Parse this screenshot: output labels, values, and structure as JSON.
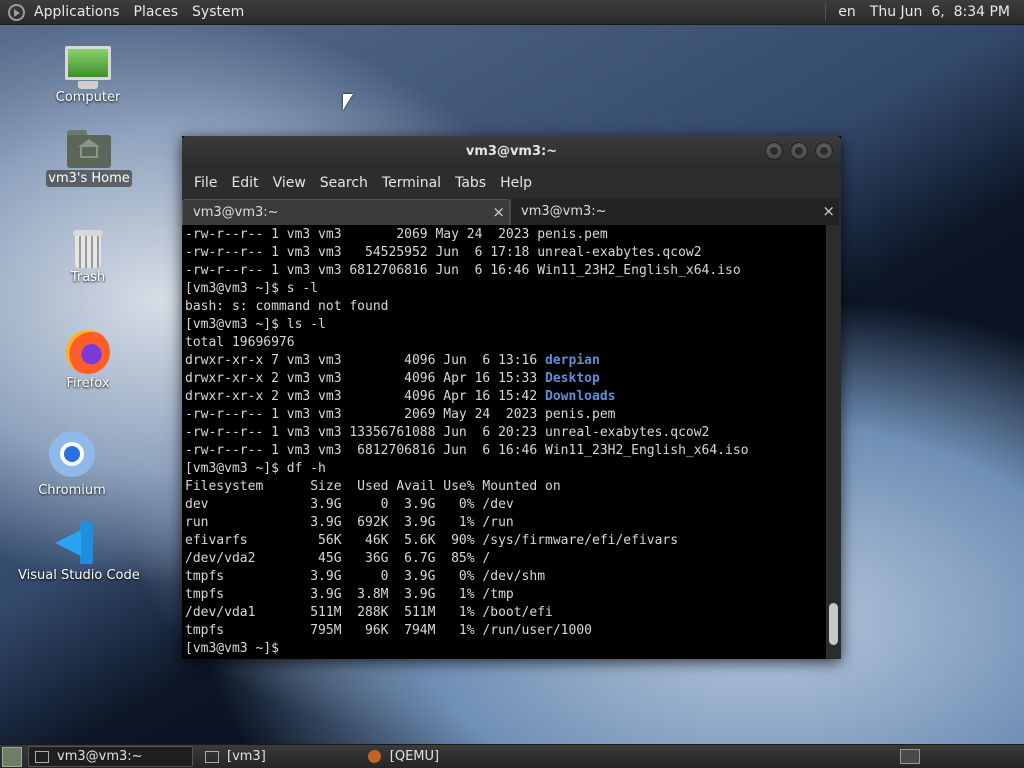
{
  "top_panel": {
    "menus": [
      "Applications",
      "Places",
      "System"
    ],
    "keyboard_layout": "en",
    "clock": "Thu Jun  6,  8:34 PM"
  },
  "desktop_icons": [
    {
      "label": "Computer"
    },
    {
      "label": "vm3's Home"
    },
    {
      "label": "Trash"
    },
    {
      "label": "Firefox"
    },
    {
      "label": "Chromium"
    },
    {
      "label": "Visual Studio Code"
    }
  ],
  "terminal": {
    "title": "vm3@vm3:~",
    "menu": [
      "File",
      "Edit",
      "View",
      "Search",
      "Terminal",
      "Tabs",
      "Help"
    ],
    "tabs": [
      {
        "label": "vm3@vm3:~",
        "close": "×"
      },
      {
        "label": "vm3@vm3:~",
        "close": "×"
      }
    ],
    "lines": [
      "-rw-r--r-- 1 vm3 vm3       2069 May 24  2023 penis.pem",
      "-rw-r--r-- 1 vm3 vm3   54525952 Jun  6 17:18 unreal-exabytes.qcow2",
      "-rw-r--r-- 1 vm3 vm3 6812706816 Jun  6 16:46 Win11_23H2_English_x64.iso",
      "[vm3@vm3 ~]$ s -l",
      "bash: s: command not found",
      "[vm3@vm3 ~]$ ls -l",
      "total 19696976",
      {
        "pre": "drwxr-xr-x 7 vm3 vm3        4096 Jun  6 13:16 ",
        "dir": "derpian"
      },
      {
        "pre": "drwxr-xr-x 2 vm3 vm3        4096 Apr 16 15:33 ",
        "dir": "Desktop"
      },
      {
        "pre": "drwxr-xr-x 2 vm3 vm3        4096 Apr 16 15:42 ",
        "dir": "Downloads"
      },
      "-rw-r--r-- 1 vm3 vm3        2069 May 24  2023 penis.pem",
      "-rw-r--r-- 1 vm3 vm3 13356761088 Jun  6 20:23 unreal-exabytes.qcow2",
      "-rw-r--r-- 1 vm3 vm3  6812706816 Jun  6 16:46 Win11_23H2_English_x64.iso",
      "[vm3@vm3 ~]$ df -h",
      "Filesystem      Size  Used Avail Use% Mounted on",
      "dev             3.9G     0  3.9G   0% /dev",
      "run             3.9G  692K  3.9G   1% /run",
      "efivarfs         56K   46K  5.6K  90% /sys/firmware/efi/efivars",
      "/dev/vda2        45G   36G  6.7G  85% /",
      "tmpfs           3.9G     0  3.9G   0% /dev/shm",
      "tmpfs           3.9G  3.8M  3.9G   1% /tmp",
      "/dev/vda1       511M  288K  511M   1% /boot/efi",
      "tmpfs           795M   96K  794M   1% /run/user/1000",
      "[vm3@vm3 ~]$ "
    ]
  },
  "taskbar": {
    "tasks": [
      {
        "label": "vm3@vm3:~"
      },
      {
        "label": "[vm3]"
      },
      {
        "label": "[QEMU]"
      }
    ]
  }
}
